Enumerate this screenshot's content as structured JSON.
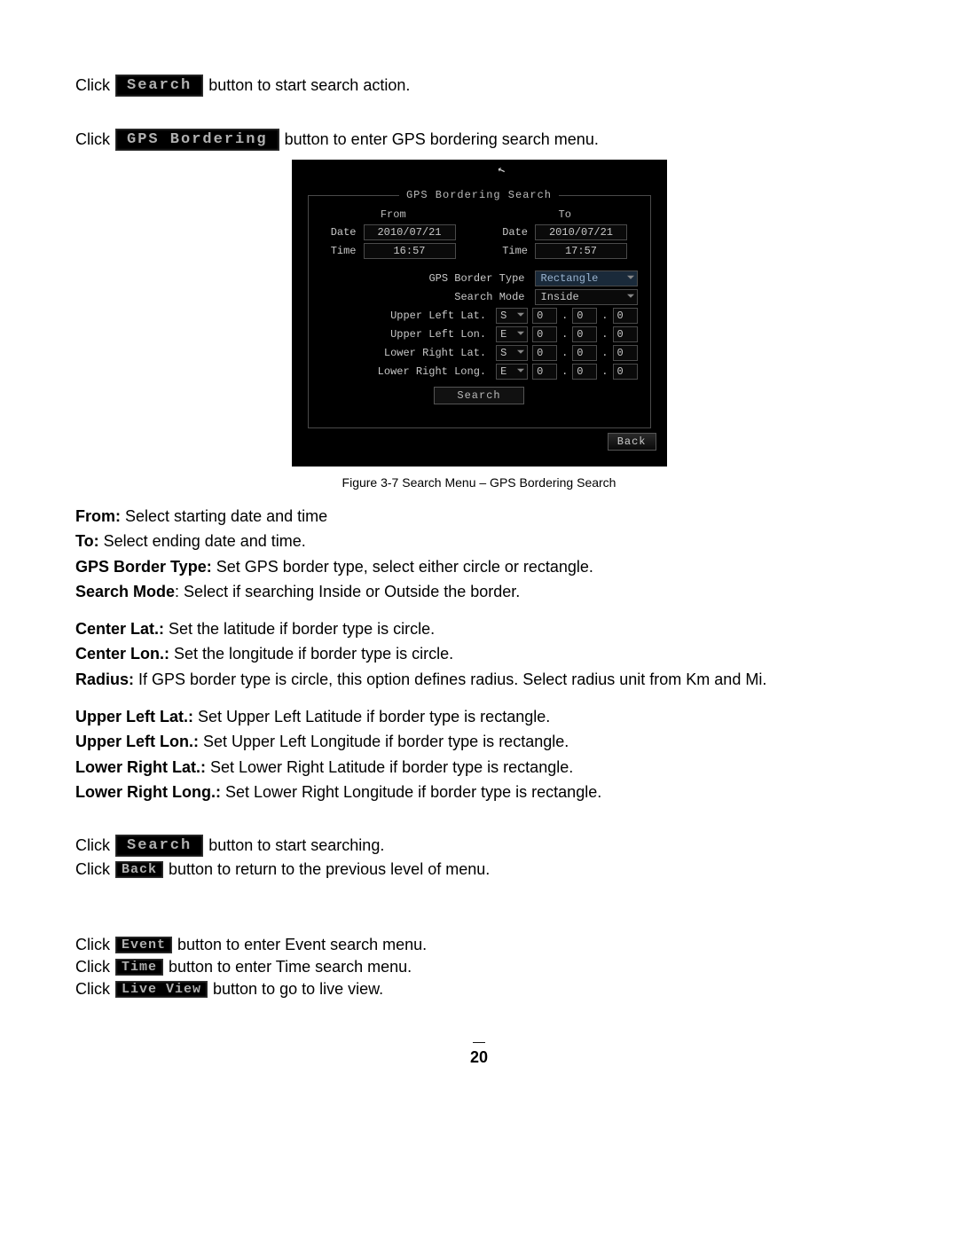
{
  "text": {
    "click": "Click",
    "btn_search": "Search",
    "btn_gps_bordering": "GPS Bordering",
    "btn_back": "Back",
    "btn_event": "Event",
    "btn_time": "Time",
    "btn_live_view": "Live View",
    "t_start_search": " button to start search action.",
    "t_enter_gps": " button to enter GPS bordering search menu.",
    "t_start_searching": " button to start searching.",
    "t_return_prev": " button to return to the previous level of menu.",
    "t_enter_event": " button to enter Event search menu.",
    "t_enter_time": " button to enter Time search menu.",
    "t_go_live": " button to go to live view.",
    "caption": "Figure 3-7 Search Menu – GPS Bordering Search",
    "from_b": "From:",
    "from_t": " Select starting date and time",
    "to_b": "To:",
    "to_t": " Select ending date and time.",
    "gbt_b": "GPS Border Type:",
    "gbt_t": " Set GPS border type, select either circle or rectangle.",
    "sm_b": "Search Mode",
    "sm_t": ": Select if searching Inside or Outside the border.",
    "clat_b": "Center Lat.:",
    "clat_t": " Set the latitude if border type is circle.",
    "clon_b": "Center Lon.:",
    "clon_t": "  Set the longitude if border type is circle.",
    "rad_b": "Radius:",
    "rad_t": " If GPS border type is circle, this option defines radius. Select radius unit from Km and Mi.",
    "ullat_b": "Upper Left Lat.:",
    "ullat_t": " Set Upper Left Latitude if border type is rectangle.",
    "ullon_b": "Upper Left Lon.:",
    "ullon_t": " Set Upper Left Longitude if border type is rectangle.",
    "lrlat_b": "Lower Right Lat.:",
    "lrlat_t": " Set Lower Right Latitude if border type is rectangle.",
    "lrlon_b": "Lower Right Long.:",
    "lrlon_t": " Set Lower Right Longitude if border type is rectangle.",
    "page_dash": "—",
    "page_num": "20"
  },
  "dialog": {
    "title": "GPS Bordering Search",
    "from": "From",
    "to": "To",
    "date_label": "Date",
    "time_label": "Time",
    "date_from": "2010/07/21",
    "time_from": "16:57",
    "date_to": "2010/07/21",
    "time_to": "17:57",
    "gps_border_type_label": "GPS Border Type",
    "gps_border_type_value": "Rectangle",
    "search_mode_label": "Search Mode",
    "search_mode_value": "Inside",
    "ullat_label": "Upper Left Lat.",
    "ullon_label": "Upper Left Lon.",
    "lrlat_label": "Lower Right Lat.",
    "lrlon_label": "Lower Right Long.",
    "s": "S",
    "e": "E",
    "zero": "0",
    "search_btn": "Search",
    "back_btn": "Back"
  }
}
